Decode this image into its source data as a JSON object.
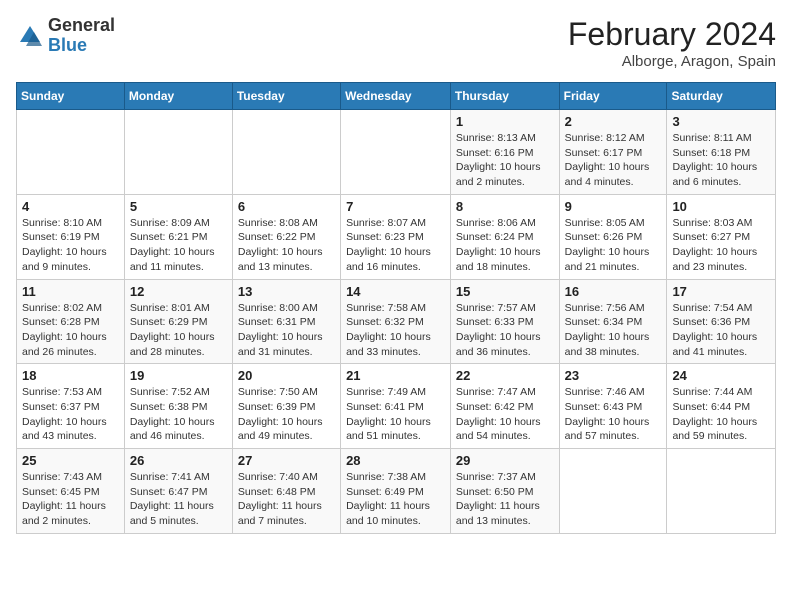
{
  "header": {
    "logo_general": "General",
    "logo_blue": "Blue",
    "month_title": "February 2024",
    "subtitle": "Alborge, Aragon, Spain"
  },
  "days_of_week": [
    "Sunday",
    "Monday",
    "Tuesday",
    "Wednesday",
    "Thursday",
    "Friday",
    "Saturday"
  ],
  "weeks": [
    [
      {
        "day": "",
        "info": ""
      },
      {
        "day": "",
        "info": ""
      },
      {
        "day": "",
        "info": ""
      },
      {
        "day": "",
        "info": ""
      },
      {
        "day": "1",
        "info": "Sunrise: 8:13 AM\nSunset: 6:16 PM\nDaylight: 10 hours and 2 minutes."
      },
      {
        "day": "2",
        "info": "Sunrise: 8:12 AM\nSunset: 6:17 PM\nDaylight: 10 hours and 4 minutes."
      },
      {
        "day": "3",
        "info": "Sunrise: 8:11 AM\nSunset: 6:18 PM\nDaylight: 10 hours and 6 minutes."
      }
    ],
    [
      {
        "day": "4",
        "info": "Sunrise: 8:10 AM\nSunset: 6:19 PM\nDaylight: 10 hours and 9 minutes."
      },
      {
        "day": "5",
        "info": "Sunrise: 8:09 AM\nSunset: 6:21 PM\nDaylight: 10 hours and 11 minutes."
      },
      {
        "day": "6",
        "info": "Sunrise: 8:08 AM\nSunset: 6:22 PM\nDaylight: 10 hours and 13 minutes."
      },
      {
        "day": "7",
        "info": "Sunrise: 8:07 AM\nSunset: 6:23 PM\nDaylight: 10 hours and 16 minutes."
      },
      {
        "day": "8",
        "info": "Sunrise: 8:06 AM\nSunset: 6:24 PM\nDaylight: 10 hours and 18 minutes."
      },
      {
        "day": "9",
        "info": "Sunrise: 8:05 AM\nSunset: 6:26 PM\nDaylight: 10 hours and 21 minutes."
      },
      {
        "day": "10",
        "info": "Sunrise: 8:03 AM\nSunset: 6:27 PM\nDaylight: 10 hours and 23 minutes."
      }
    ],
    [
      {
        "day": "11",
        "info": "Sunrise: 8:02 AM\nSunset: 6:28 PM\nDaylight: 10 hours and 26 minutes."
      },
      {
        "day": "12",
        "info": "Sunrise: 8:01 AM\nSunset: 6:29 PM\nDaylight: 10 hours and 28 minutes."
      },
      {
        "day": "13",
        "info": "Sunrise: 8:00 AM\nSunset: 6:31 PM\nDaylight: 10 hours and 31 minutes."
      },
      {
        "day": "14",
        "info": "Sunrise: 7:58 AM\nSunset: 6:32 PM\nDaylight: 10 hours and 33 minutes."
      },
      {
        "day": "15",
        "info": "Sunrise: 7:57 AM\nSunset: 6:33 PM\nDaylight: 10 hours and 36 minutes."
      },
      {
        "day": "16",
        "info": "Sunrise: 7:56 AM\nSunset: 6:34 PM\nDaylight: 10 hours and 38 minutes."
      },
      {
        "day": "17",
        "info": "Sunrise: 7:54 AM\nSunset: 6:36 PM\nDaylight: 10 hours and 41 minutes."
      }
    ],
    [
      {
        "day": "18",
        "info": "Sunrise: 7:53 AM\nSunset: 6:37 PM\nDaylight: 10 hours and 43 minutes."
      },
      {
        "day": "19",
        "info": "Sunrise: 7:52 AM\nSunset: 6:38 PM\nDaylight: 10 hours and 46 minutes."
      },
      {
        "day": "20",
        "info": "Sunrise: 7:50 AM\nSunset: 6:39 PM\nDaylight: 10 hours and 49 minutes."
      },
      {
        "day": "21",
        "info": "Sunrise: 7:49 AM\nSunset: 6:41 PM\nDaylight: 10 hours and 51 minutes."
      },
      {
        "day": "22",
        "info": "Sunrise: 7:47 AM\nSunset: 6:42 PM\nDaylight: 10 hours and 54 minutes."
      },
      {
        "day": "23",
        "info": "Sunrise: 7:46 AM\nSunset: 6:43 PM\nDaylight: 10 hours and 57 minutes."
      },
      {
        "day": "24",
        "info": "Sunrise: 7:44 AM\nSunset: 6:44 PM\nDaylight: 10 hours and 59 minutes."
      }
    ],
    [
      {
        "day": "25",
        "info": "Sunrise: 7:43 AM\nSunset: 6:45 PM\nDaylight: 11 hours and 2 minutes."
      },
      {
        "day": "26",
        "info": "Sunrise: 7:41 AM\nSunset: 6:47 PM\nDaylight: 11 hours and 5 minutes."
      },
      {
        "day": "27",
        "info": "Sunrise: 7:40 AM\nSunset: 6:48 PM\nDaylight: 11 hours and 7 minutes."
      },
      {
        "day": "28",
        "info": "Sunrise: 7:38 AM\nSunset: 6:49 PM\nDaylight: 11 hours and 10 minutes."
      },
      {
        "day": "29",
        "info": "Sunrise: 7:37 AM\nSunset: 6:50 PM\nDaylight: 11 hours and 13 minutes."
      },
      {
        "day": "",
        "info": ""
      },
      {
        "day": "",
        "info": ""
      }
    ]
  ]
}
